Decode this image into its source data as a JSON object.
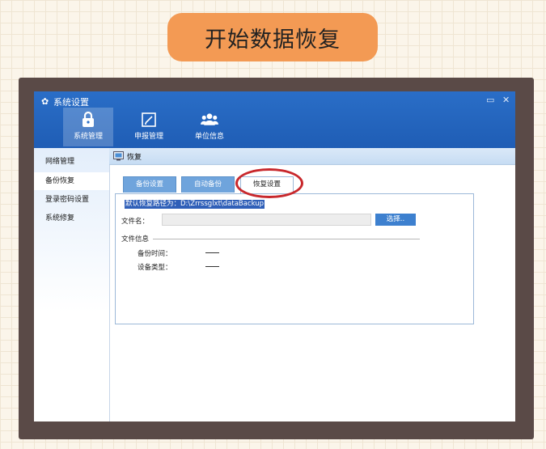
{
  "banner": {
    "title": "开始数据恢复"
  },
  "window": {
    "title": "系统设置",
    "nav": [
      {
        "label": "系统管理",
        "icon": "lock-icon",
        "active": true
      },
      {
        "label": "申报管理",
        "icon": "edit-icon",
        "active": false
      },
      {
        "label": "单位信息",
        "icon": "users-icon",
        "active": false
      }
    ],
    "controls": {
      "restore": "▭",
      "close": "✕"
    }
  },
  "sidebar": {
    "items": [
      {
        "label": "网络管理",
        "active": false
      },
      {
        "label": "备份恢复",
        "active": true
      },
      {
        "label": "登录密码设置",
        "active": false
      },
      {
        "label": "系统修复",
        "active": false
      }
    ]
  },
  "content": {
    "header": "恢复",
    "tabs": [
      {
        "label": "备份设置",
        "active": false
      },
      {
        "label": "自动备份",
        "active": false
      },
      {
        "label": "恢复设置",
        "active": true
      }
    ],
    "default_path": "默认恢复路径为：D:\\Zrrssglxt\\dataBackup",
    "file_name_label": "文件名：",
    "file_name_value": "",
    "select_button": "选择..",
    "file_info_title": "文件信息",
    "backup_time_label": "备份时间：",
    "device_type_label": "设备类型："
  },
  "colors": {
    "accent": "#1f5db5",
    "banner": "#f39a54",
    "annotation": "#c8282c"
  }
}
